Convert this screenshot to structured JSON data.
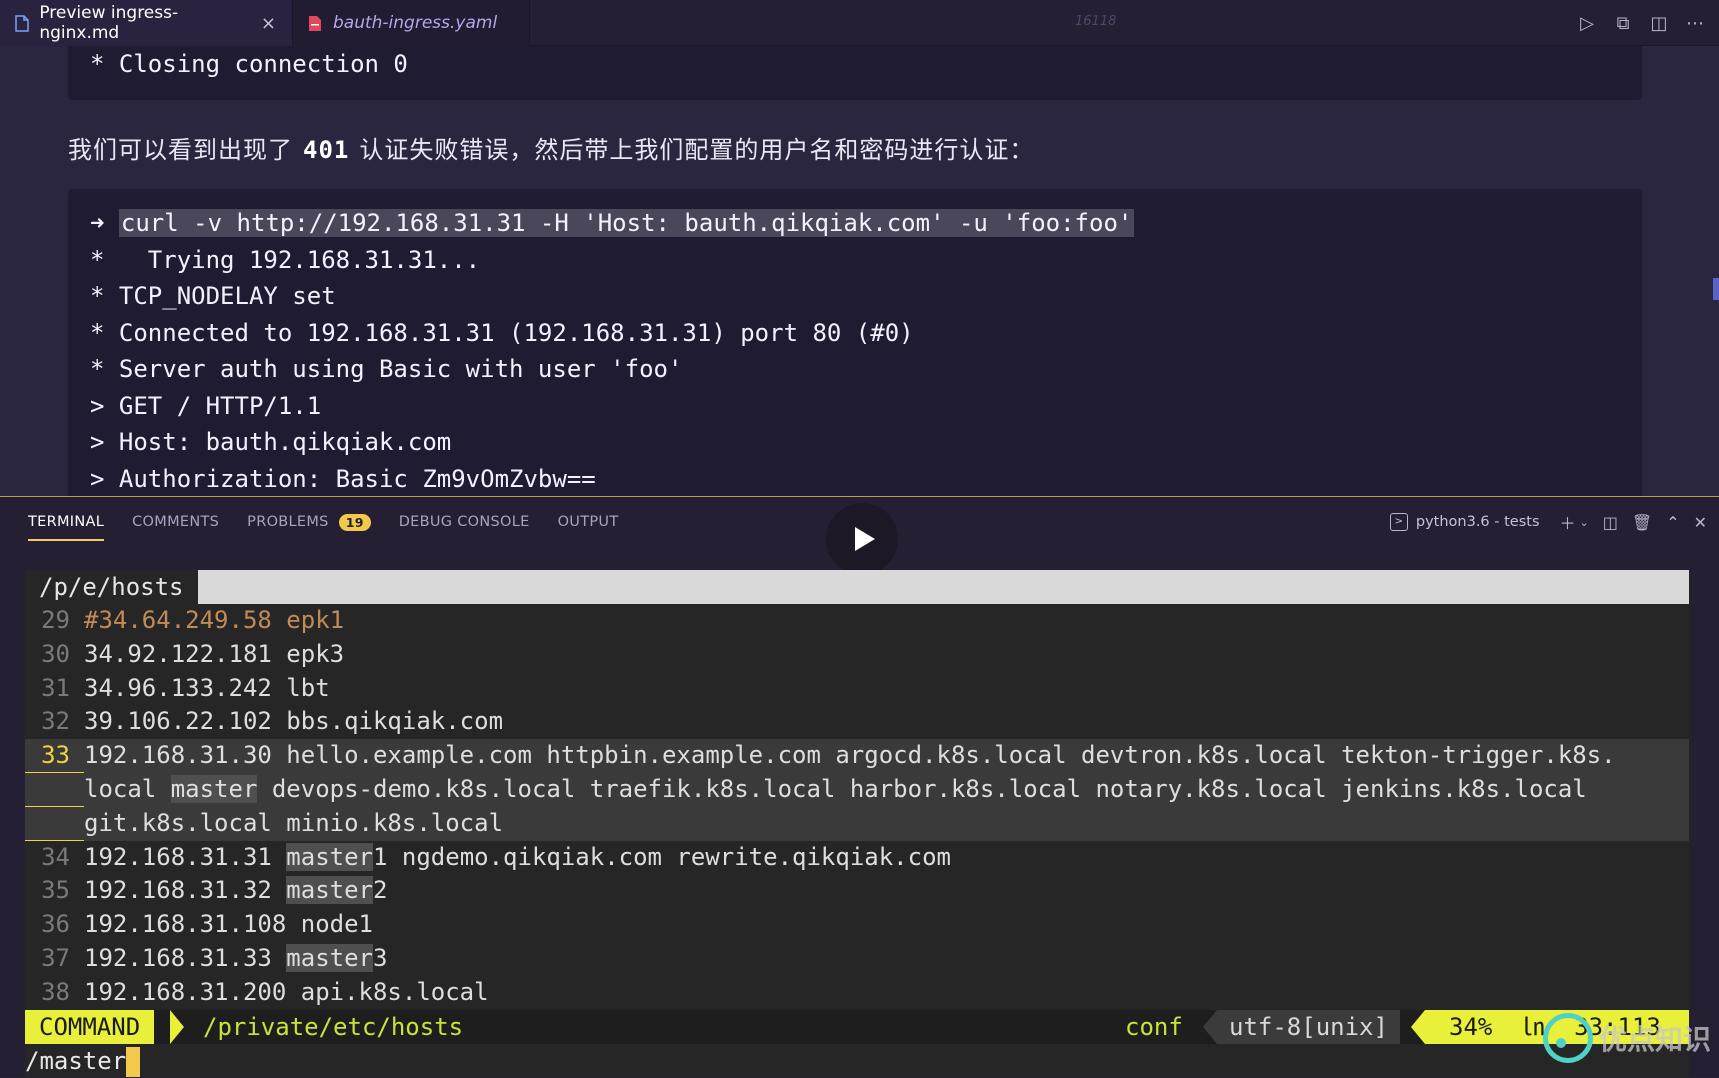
{
  "tabs": {
    "active_label": "Preview ingress-nginx.md",
    "inactive_label": "bauth-ingress.yaml",
    "ghost_text": "16118"
  },
  "preview": {
    "top_block_line": "* Closing connection 0",
    "paragraph_before": "我们可以看到出现了",
    "paragraph_num": "401",
    "paragraph_after": "认证失败错误，然后带上我们配置的用户名和密码进行认证：",
    "prompt_symbol": "➜",
    "command": "curl -v http://192.168.31.31 -H 'Host: bauth.qikqiak.com' -u 'foo:foo'",
    "output_lines": [
      "*   Trying 192.168.31.31...",
      "* TCP_NODELAY set",
      "* Connected to 192.168.31.31 (192.168.31.31) port 80 (#0)",
      "* Server auth using Basic with user 'foo'",
      "> GET / HTTP/1.1",
      "> Host: bauth.qikqiak.com",
      "> Authorization: Basic Zm9vOmZvbw=="
    ]
  },
  "panel": {
    "tabs": [
      "TERMINAL",
      "COMMENTS",
      "PROBLEMS",
      "DEBUG CONSOLE",
      "OUTPUT"
    ],
    "problems_count": "19",
    "shell_label": "python3.6 - tests"
  },
  "vim": {
    "tab_name": "/p/e/hosts",
    "lines": {
      "l29": {
        "num": "29",
        "text": "#34.64.249.58 epk1"
      },
      "l30": {
        "num": "30",
        "text": "34.92.122.181 epk3"
      },
      "l31": {
        "num": "31",
        "text": "34.96.133.242 lbt"
      },
      "l32": {
        "num": "32",
        "text": "39.106.22.102 bbs.qikqiak.com"
      },
      "l33": {
        "num": "33",
        "a": "192.168.31.30 hello.example.com httpbin.example.com argocd.k8s.local devtron.k8s.local tekton-trigger.k8s.",
        "b1": "local ",
        "b_match": "master",
        "b2": " devops-demo.k8s.local traefik.k8s.local harbor.k8s.local notary.k8s.local jenkins.k8s.local",
        "c": "git.k8s.local minio.k8s.local"
      },
      "l34": {
        "num": "34",
        "pre": "192.168.31.31 ",
        "match": "master",
        "post": "1 ngdemo.qikqiak.com rewrite.qikqiak.com"
      },
      "l35": {
        "num": "35",
        "pre": "192.168.31.32 ",
        "match": "master",
        "post": "2"
      },
      "l36": {
        "num": "36",
        "text": "192.168.31.108 node1"
      },
      "l37": {
        "num": "37",
        "pre": "192.168.31.33 ",
        "match": "master",
        "post": "3"
      },
      "l38": {
        "num": "38",
        "text": "192.168.31.200 api.k8s.local"
      }
    },
    "status": {
      "mode": "COMMAND",
      "path": "/private/etc/hosts",
      "filetype": "conf",
      "encoding": "utf-8[unix]",
      "position": "34%  ㏑  33:113"
    },
    "cmdline": "/master"
  },
  "watermark": "优点知识"
}
